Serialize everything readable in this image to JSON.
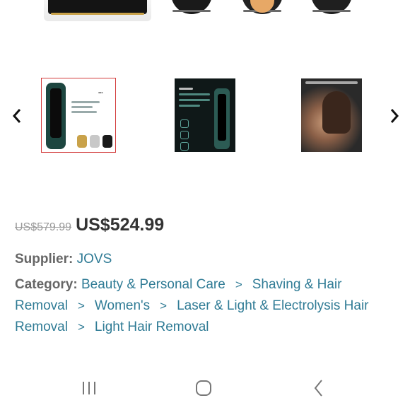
{
  "product": {
    "old_price": "US$579.99",
    "price": "US$524.99",
    "supplier_label": "Supplier:",
    "supplier_name": "JOVS",
    "category_label": "Category:",
    "categories": [
      "Beauty & Personal Care",
      "Shaving & Hair Removal",
      "Women's",
      "Laser & Light & Electrolysis Hair Removal",
      "Light Hair Removal"
    ],
    "category_separator": ">"
  },
  "gallery": {
    "selected_index": 0,
    "thumbnails": [
      {
        "icon": "product-device-thumbnail"
      },
      {
        "icon": "product-infographic-thumbnail"
      },
      {
        "icon": "lifestyle-photo-thumbnail"
      }
    ]
  },
  "colors": {
    "link": "#2f7b95",
    "price": "#333333",
    "old_price": "#9a9a9a",
    "selected_thumb_border": "#d33b3b"
  },
  "nav": {
    "buttons": [
      "recents-icon",
      "home-icon",
      "back-icon"
    ]
  }
}
